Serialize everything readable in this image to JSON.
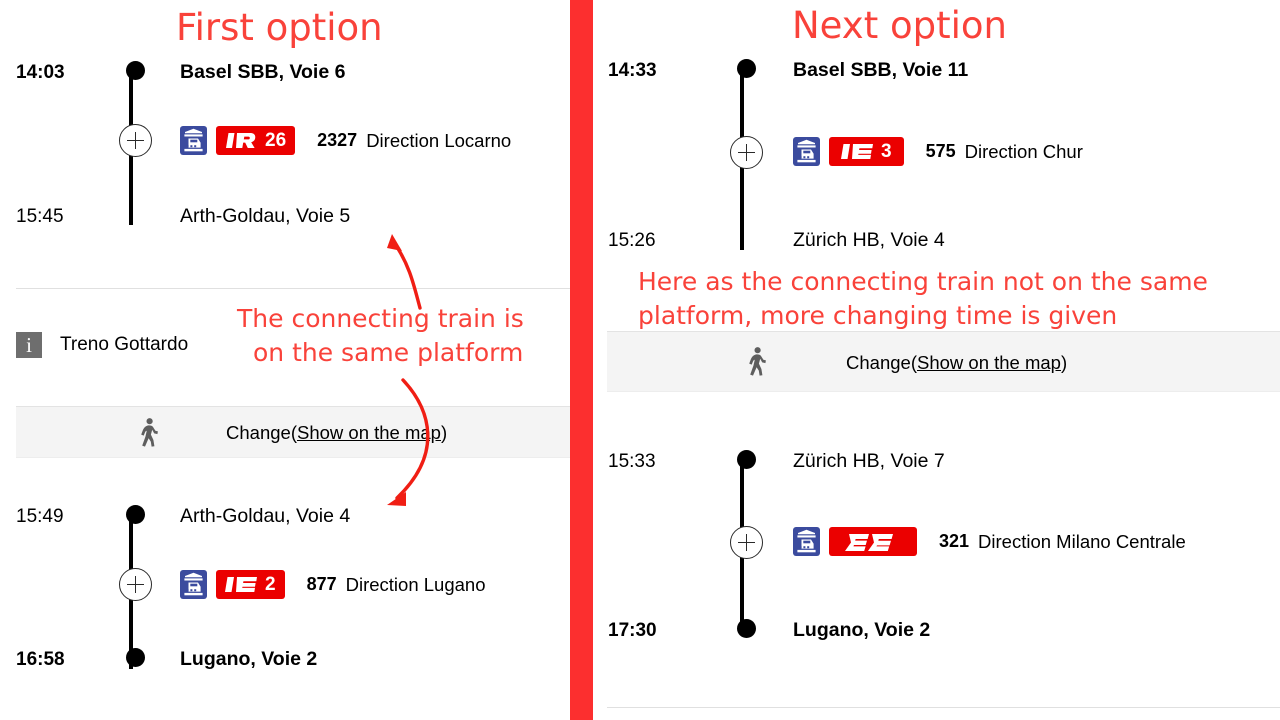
{
  "colors": {
    "annotation_red": "#f9423a",
    "divider_red": "#fc2f2f",
    "badge_red": "#eb0000",
    "train_icon_blue": "#3b4b9e",
    "info_grey": "#6e6e6e",
    "change_row_grey": "#f4f4f4"
  },
  "left_panel": {
    "annotation_title": "First option",
    "annotation_note_line1": "The connecting train is",
    "annotation_note_line2": "on the same platform",
    "legs": [
      {
        "depart_time": "14:03",
        "depart_station": "Basel SBB, Voie 6",
        "arrive_time": "15:45",
        "arrive_station": "Arth-Goldau, Voie 5",
        "service": {
          "icon": "train-icon",
          "product": "IR",
          "line": "26",
          "number": "2327",
          "direction": "Direction Locarno"
        }
      },
      {
        "depart_time": "15:49",
        "depart_station": "Arth-Goldau, Voie 4",
        "arrive_time": "16:58",
        "arrive_station": "Lugano, Voie 2",
        "service": {
          "icon": "train-icon",
          "product": "IC",
          "line": "2",
          "number": "877",
          "direction": "Direction Lugano"
        }
      }
    ],
    "note": {
      "icon": "info-icon",
      "text": "Treno Gottardo"
    },
    "change": {
      "icon": "walking-person-icon",
      "label": "Change",
      "open_paren": "(",
      "link": "Show on the map",
      "close_paren": ")"
    }
  },
  "right_panel": {
    "annotation_title": "Next option",
    "annotation_note_line1": "Here as the connecting train not on the same",
    "annotation_note_line2": "platform, more changing time is given",
    "legs": [
      {
        "depart_time": "14:33",
        "depart_station": "Basel SBB, Voie 11",
        "arrive_time": "15:26",
        "arrive_station": "Zürich HB, Voie 4",
        "service": {
          "icon": "train-icon",
          "product": "IC",
          "line": "3",
          "number": "575",
          "direction": "Direction Chur"
        }
      },
      {
        "depart_time": "15:33",
        "depart_station": "Zürich HB, Voie 7",
        "arrive_time": "17:30",
        "arrive_station": "Lugano, Voie 2",
        "service": {
          "icon": "train-icon",
          "product": "EC",
          "line": "",
          "number": "321",
          "direction": "Direction Milano Centrale"
        }
      }
    ],
    "change": {
      "icon": "walking-person-icon",
      "label": "Change",
      "open_paren": "(",
      "link": "Show on the map",
      "close_paren": ")"
    }
  }
}
